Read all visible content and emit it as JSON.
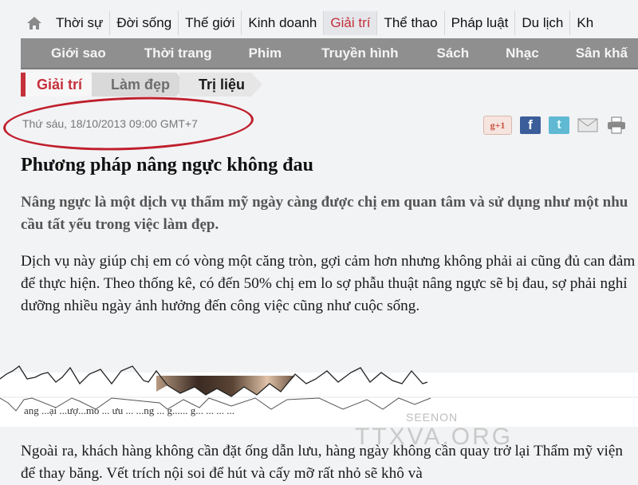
{
  "top_nav": {
    "home_icon": "home-icon",
    "items": [
      {
        "label": "Thời sự",
        "active": false
      },
      {
        "label": "Đời sống",
        "active": false
      },
      {
        "label": "Thế giới",
        "active": false
      },
      {
        "label": "Kinh doanh",
        "active": false
      },
      {
        "label": "Giải trí",
        "active": true
      },
      {
        "label": "Thể thao",
        "active": false
      },
      {
        "label": "Pháp luật",
        "active": false
      },
      {
        "label": "Du lịch",
        "active": false
      },
      {
        "label": "Kh",
        "active": false
      }
    ]
  },
  "sub_nav": {
    "items": [
      "Giới sao",
      "Thời trang",
      "Phim",
      "Truyền hình",
      "Sách",
      "Nhạc",
      "Sân khấ"
    ]
  },
  "breadcrumb": [
    "Giải trí",
    "Làm đẹp",
    "Trị liệu"
  ],
  "article": {
    "date": "Thứ sáu, 18/10/2013 09:00 GMT+7",
    "share": [
      {
        "icon": "google-plus-icon",
        "label": "g+1"
      },
      {
        "icon": "facebook-icon",
        "label": "f"
      },
      {
        "icon": "twitter-icon",
        "label": "t"
      },
      {
        "icon": "email-icon",
        "label": ""
      },
      {
        "icon": "print-icon",
        "label": ""
      }
    ],
    "title": "Phương pháp nâng ngực không đau",
    "lead": "Nâng ngực là một dịch vụ thẩm mỹ ngày càng được chị em quan tâm và sử dụng như một nhu cầu tất yếu trong việc làm đẹp.",
    "paragraph1": "Dịch vụ này giúp chị em có vòng một căng tròn, gợi cảm hơn nhưng không phải ai cũng đủ can đảm để thực hiện. Theo thống kê, có đến 50% chị em lo sợ phẫu thuật nâng ngực sẽ bị đau, sợ phải nghỉ dưỡng nhiều ngày ảnh hưởng đến công việc cũng như cuộc sống.",
    "paragraph2": "Ngoài ra, khách hàng không cần đặt ống dẫn lưu, hàng ngày không cần quay trở lại Thẩm mỹ viện để thay băng. Vết trích nội soi để hút và cấy mỡ rất nhỏ sẽ khô và"
  },
  "watermark": {
    "line1": "SEENON",
    "line2": "TTXVA.ORG"
  },
  "colors": {
    "accent": "#c5303b",
    "subnav_bg": "#8f8f8f",
    "oval": "#c01f2c"
  }
}
